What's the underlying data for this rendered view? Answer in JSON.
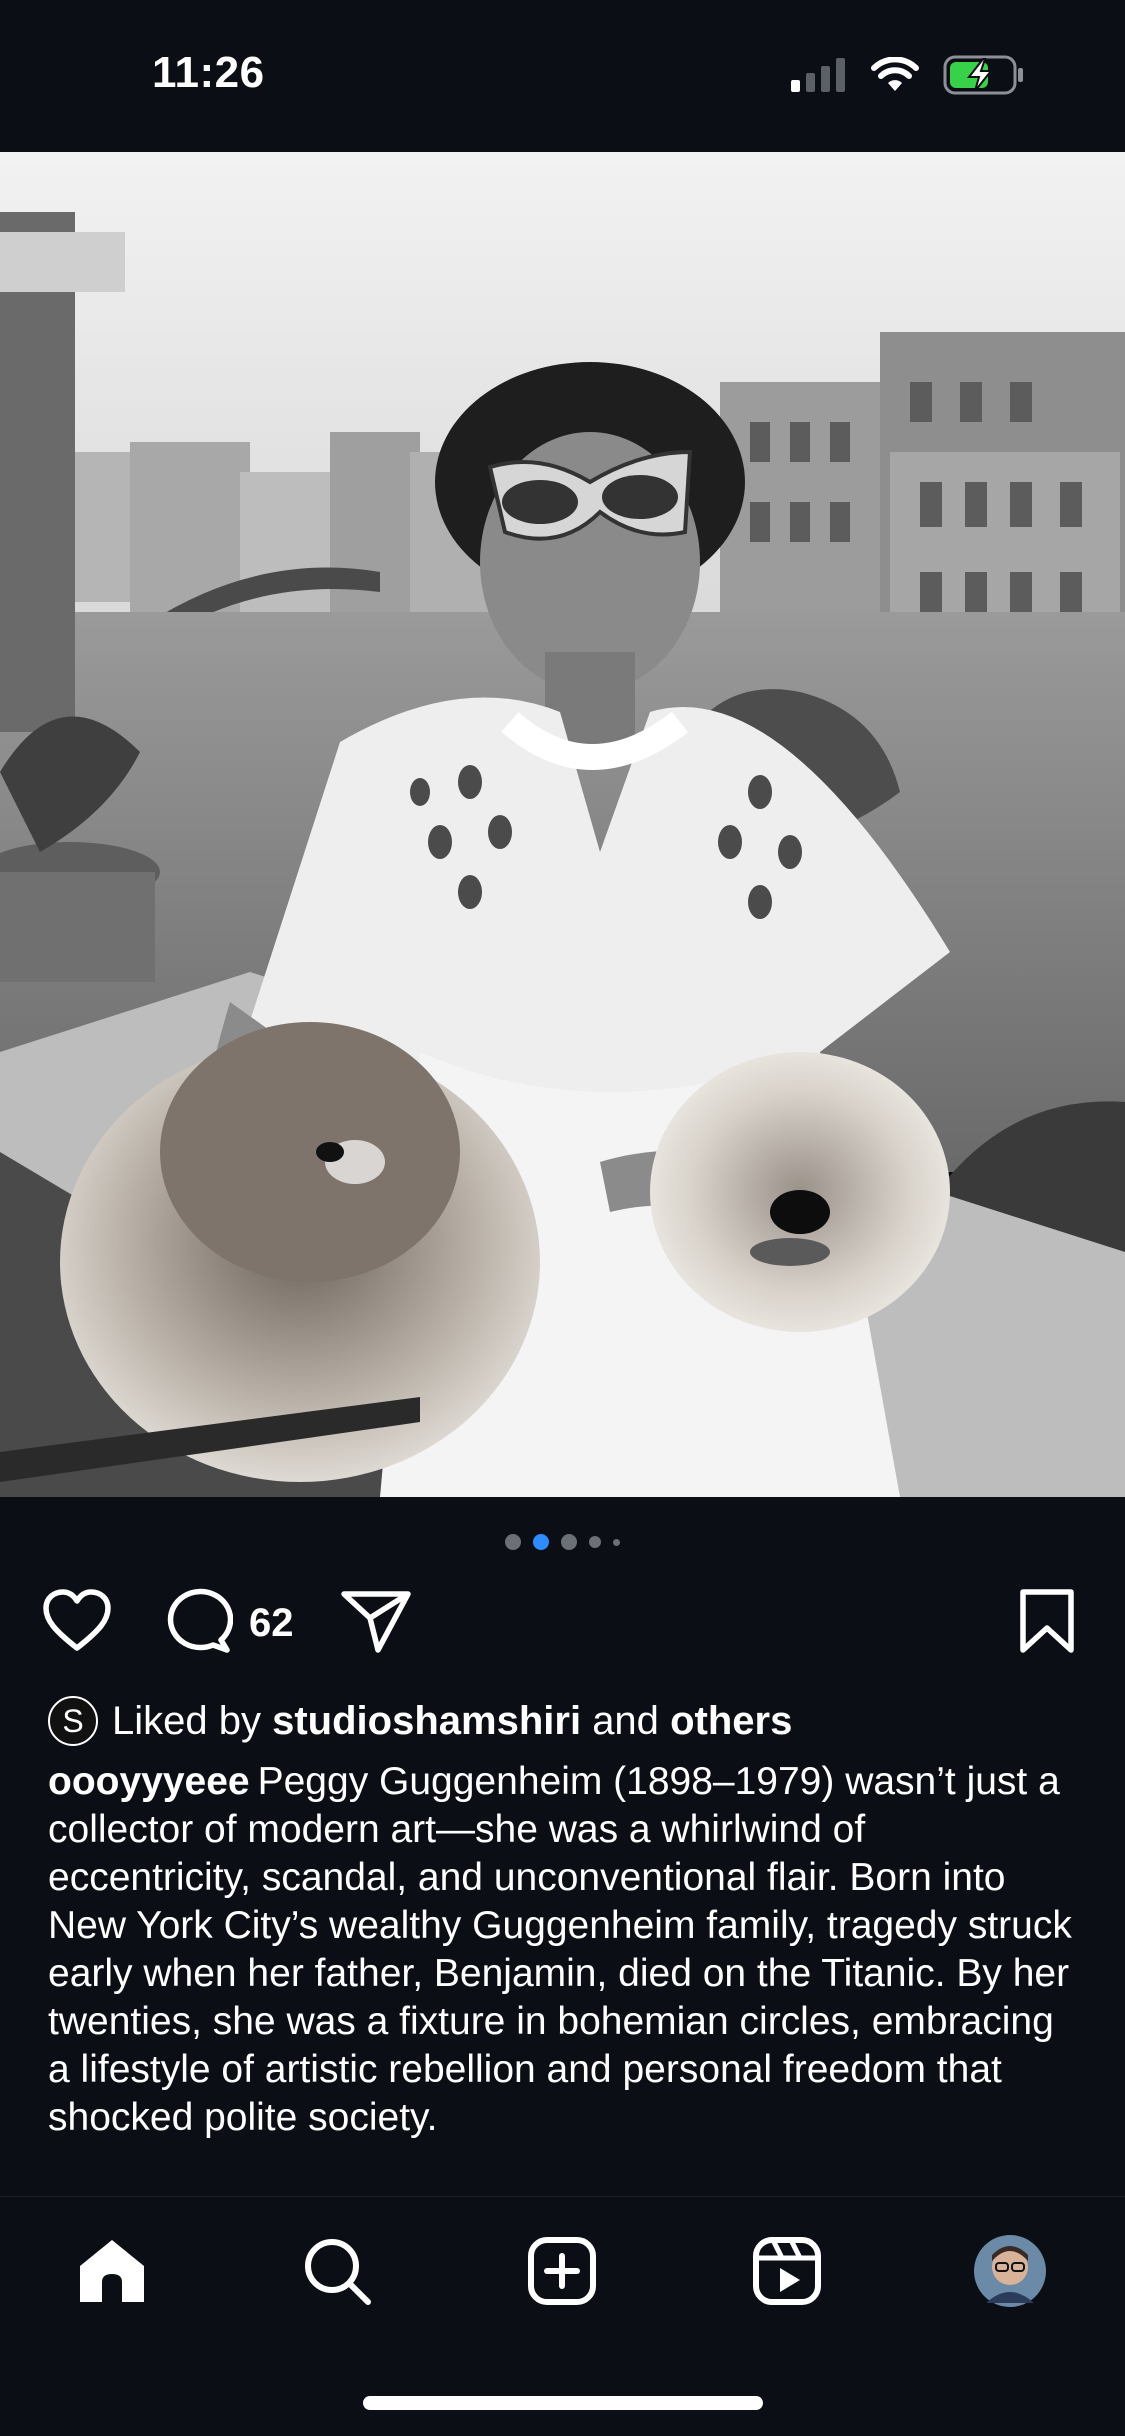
{
  "status_bar": {
    "time": "11:26",
    "icons": [
      "cellular-signal-icon",
      "wifi-icon",
      "battery-charging-icon"
    ]
  },
  "post": {
    "image": {
      "description_icon": "photo-image",
      "carousel": {
        "count": 5,
        "active_index": 1
      }
    },
    "actions": {
      "like_icon": "heart-icon",
      "comment_icon": "comment-icon",
      "comment_count": "62",
      "share_icon": "send-icon",
      "save_icon": "bookmark-icon"
    },
    "likes": {
      "avatar_letter": "S",
      "prefix": "Liked by",
      "user": "studioshamshiri",
      "conjunction": "and",
      "others": "others"
    },
    "caption": {
      "username": "oooyyyeee",
      "text": "Peggy Guggenheim (1898–1979) wasn’t just a collector of modern art—she was a whirlwind of eccentricity, scandal, and unconventional flair. Born into New York City’s wealthy Guggenheim family, tragedy struck early when her father, Benjamin, died on the Titanic. By her twenties, she was a fixture in bohemian circles, embracing a lifestyle of artistic rebellion and personal freedom that shocked polite society."
    }
  },
  "tabbar": {
    "items": [
      "home-icon",
      "search-icon",
      "create-icon",
      "reels-icon",
      "profile-avatar"
    ]
  },
  "colors": {
    "background": "#0b0e14",
    "accent_dot": "#2f8cff",
    "text": "#ffffff"
  }
}
